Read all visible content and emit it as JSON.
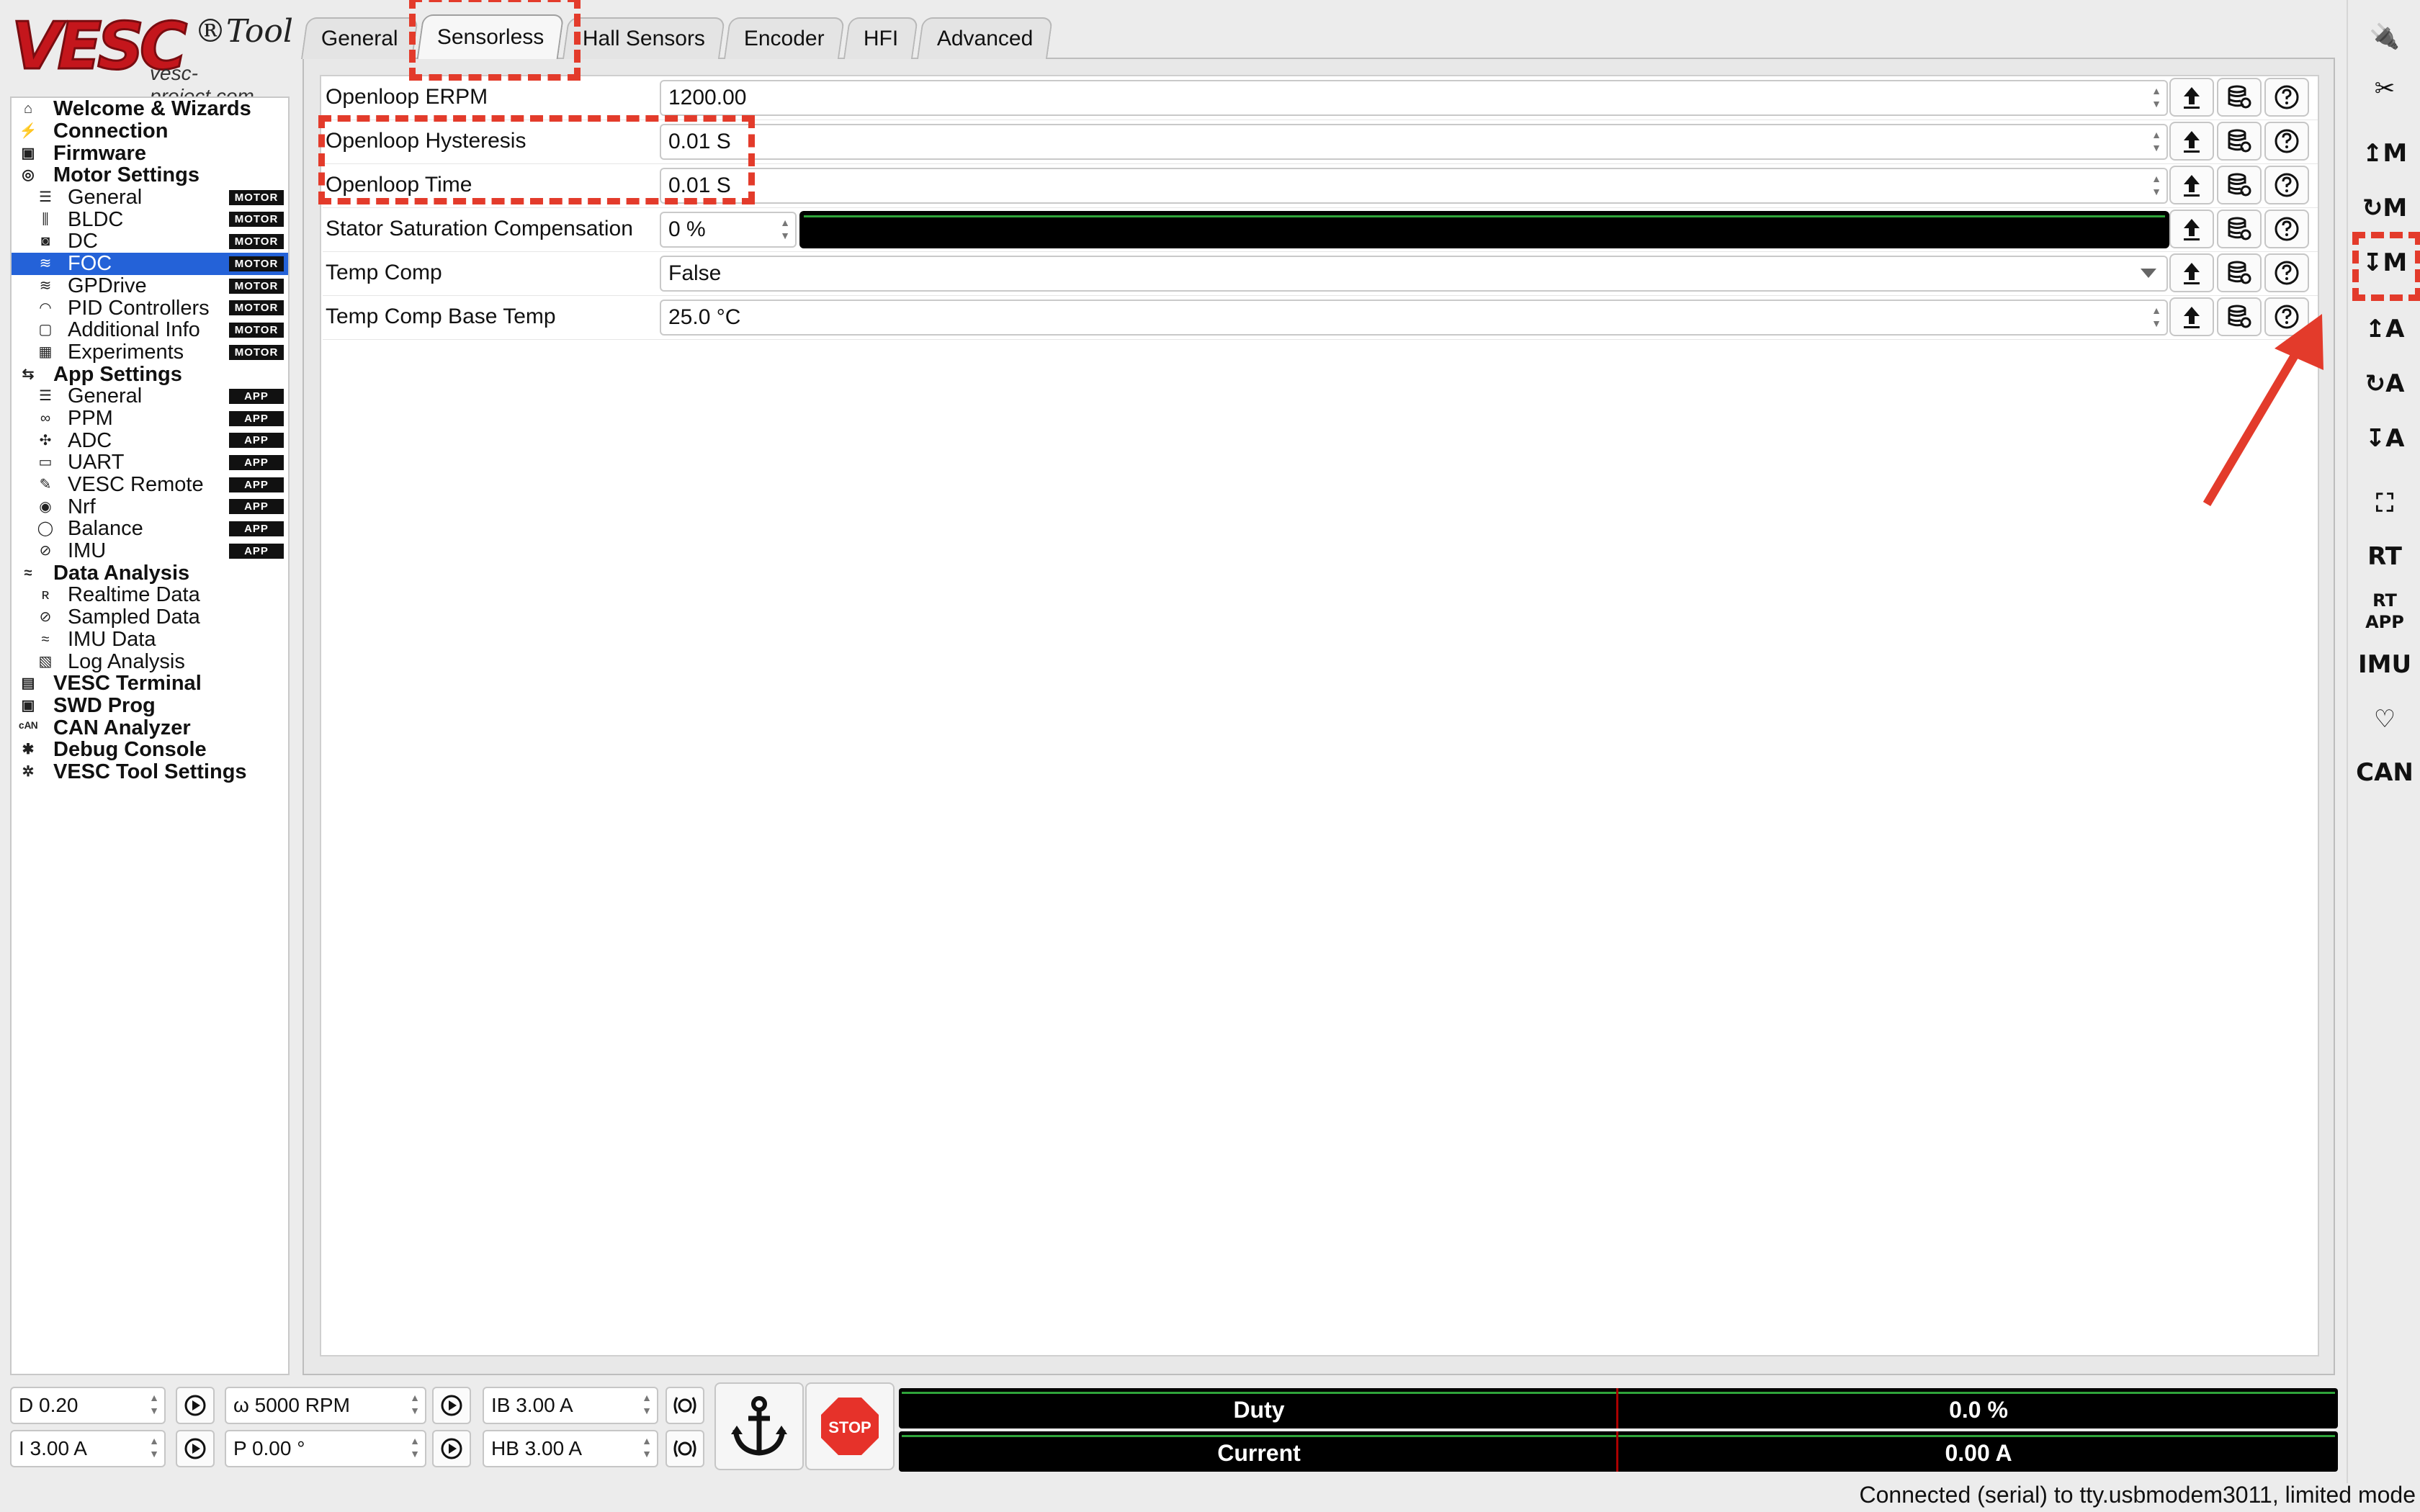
{
  "app": {
    "logo_text": "VESC",
    "logo_tool": "®Tool",
    "logo_site": "vesc-project.com"
  },
  "nav": {
    "items": [
      {
        "label": "Welcome & Wizards",
        "icon": "home-icon",
        "glyph": "⌂",
        "level": "top",
        "badge": ""
      },
      {
        "label": "Connection",
        "icon": "plug-icon",
        "glyph": "⚡",
        "level": "top",
        "badge": ""
      },
      {
        "label": "Firmware",
        "icon": "chip-icon",
        "glyph": "▣",
        "level": "top",
        "badge": ""
      },
      {
        "label": "Motor Settings",
        "icon": "motor-icon",
        "glyph": "◎",
        "level": "top",
        "badge": ""
      },
      {
        "label": "General",
        "icon": "sliders-icon",
        "glyph": "☰",
        "level": "sub",
        "badge": "MOTOR"
      },
      {
        "label": "BLDC",
        "icon": "bldc-icon",
        "glyph": "⫼",
        "level": "sub",
        "badge": "MOTOR"
      },
      {
        "label": "DC",
        "icon": "dc-motor-icon",
        "glyph": "◙",
        "level": "sub",
        "badge": "MOTOR"
      },
      {
        "label": "FOC",
        "icon": "foc-icon",
        "glyph": "≋",
        "level": "sub",
        "badge": "MOTOR",
        "selected": true
      },
      {
        "label": "GPDrive",
        "icon": "gpdrive-icon",
        "glyph": "≋",
        "level": "sub",
        "badge": "MOTOR"
      },
      {
        "label": "PID Controllers",
        "icon": "gauge-icon",
        "glyph": "◠",
        "level": "sub",
        "badge": "MOTOR"
      },
      {
        "label": "Additional Info",
        "icon": "info-icon",
        "glyph": "▢",
        "level": "sub",
        "badge": "MOTOR"
      },
      {
        "label": "Experiments",
        "icon": "calculator-icon",
        "glyph": "▦",
        "level": "sub",
        "badge": "MOTOR"
      },
      {
        "label": "App Settings",
        "icon": "app-settings-icon",
        "glyph": "⇆",
        "level": "top",
        "badge": ""
      },
      {
        "label": "General",
        "icon": "sliders-icon",
        "glyph": "☰",
        "level": "sub",
        "badge": "APP"
      },
      {
        "label": "PPM",
        "icon": "ppm-icon",
        "glyph": "∞",
        "level": "sub",
        "badge": "APP"
      },
      {
        "label": "ADC",
        "icon": "adc-icon",
        "glyph": "✣",
        "level": "sub",
        "badge": "APP"
      },
      {
        "label": "UART",
        "icon": "keyboard-icon",
        "glyph": "▭",
        "level": "sub",
        "badge": "APP"
      },
      {
        "label": "VESC Remote",
        "icon": "remote-icon",
        "glyph": "✎",
        "level": "sub",
        "badge": "APP"
      },
      {
        "label": "Nrf",
        "icon": "wireless-icon",
        "glyph": "◉",
        "level": "sub",
        "badge": "APP"
      },
      {
        "label": "Balance",
        "icon": "balance-icon",
        "glyph": "◯",
        "level": "sub",
        "badge": "APP"
      },
      {
        "label": "IMU",
        "icon": "imu-icon",
        "glyph": "⊘",
        "level": "sub",
        "badge": "APP"
      },
      {
        "label": "Data Analysis",
        "icon": "chart-icon",
        "glyph": "≈",
        "level": "top",
        "badge": ""
      },
      {
        "label": "Realtime Data",
        "icon": "realtime-icon",
        "glyph": "ʀ",
        "level": "sub",
        "badge": ""
      },
      {
        "label": "Sampled Data",
        "icon": "sampled-icon",
        "glyph": "⊘",
        "level": "sub",
        "badge": ""
      },
      {
        "label": "IMU Data",
        "icon": "imu-data-icon",
        "glyph": "≈",
        "level": "sub",
        "badge": ""
      },
      {
        "label": "Log Analysis",
        "icon": "log-icon",
        "glyph": "▧",
        "level": "sub",
        "badge": ""
      },
      {
        "label": "VESC Terminal",
        "icon": "terminal-icon",
        "glyph": "▤",
        "level": "top",
        "badge": ""
      },
      {
        "label": "SWD Prog",
        "icon": "swd-icon",
        "glyph": "▣",
        "level": "top",
        "badge": ""
      },
      {
        "label": "CAN Analyzer",
        "icon": "can-icon",
        "glyph": "ᶜᴬᴺ",
        "level": "top",
        "badge": ""
      },
      {
        "label": "Debug Console",
        "icon": "bug-icon",
        "glyph": "✱",
        "level": "top",
        "badge": ""
      },
      {
        "label": "VESC Tool Settings",
        "icon": "gear-icon",
        "glyph": "✲",
        "level": "top",
        "badge": ""
      }
    ]
  },
  "tabs": [
    {
      "label": "General",
      "active": false
    },
    {
      "label": "Sensorless",
      "active": true
    },
    {
      "label": "Hall Sensors",
      "active": false
    },
    {
      "label": "Encoder",
      "active": false
    },
    {
      "label": "HFI",
      "active": false
    },
    {
      "label": "Advanced",
      "active": false
    }
  ],
  "params": [
    {
      "label": "Openloop ERPM",
      "value": "1200.00",
      "kind": "spin"
    },
    {
      "label": "Openloop Hysteresis",
      "value": "0.01 S",
      "kind": "spin"
    },
    {
      "label": "Openloop Time",
      "value": "0.01 S",
      "kind": "spin"
    },
    {
      "label": "Stator Saturation Compensation",
      "value": "0 %",
      "kind": "slider",
      "level": 0
    },
    {
      "label": "Temp Comp",
      "value": "False",
      "kind": "dropdown"
    },
    {
      "label": "Temp Comp Base Temp",
      "value": "25.0 °C",
      "kind": "spin"
    }
  ],
  "param_buttons": {
    "write": "upload-icon",
    "read_default": "database-reset-icon",
    "help": "help-icon"
  },
  "right_toolbar": [
    {
      "name": "connect-icon",
      "label": "🔌"
    },
    {
      "name": "disconnect-icon",
      "label": "✂"
    },
    {
      "name": "write-motor-config-icon",
      "label": "↥M"
    },
    {
      "name": "read-motor-config-icon",
      "label": "↻M"
    },
    {
      "name": "read-default-motor-config-icon",
      "label": "↧M"
    },
    {
      "name": "write-app-config-icon",
      "label": "↥A"
    },
    {
      "name": "read-app-config-icon",
      "label": "↻A"
    },
    {
      "name": "read-default-app-config-icon",
      "label": "↧A"
    },
    {
      "name": "can-devices-icon",
      "label": "⛶"
    },
    {
      "name": "realtime-data-icon",
      "label": "RT"
    },
    {
      "name": "realtime-app-data-icon",
      "label": "RT APP"
    },
    {
      "name": "imu-stream-icon",
      "label": "IMU"
    },
    {
      "name": "heartbeat-icon",
      "label": "♡"
    },
    {
      "name": "can-forward-icon",
      "label": "CAN"
    }
  ],
  "controls": {
    "duty": "D 0.20",
    "current": "I 3.00 A",
    "speed": "ω 5000 RPM",
    "position": "P 0.00 °",
    "brake": "IB 3.00 A",
    "handbrake": "HB 3.00 A",
    "stop_label": "STOP"
  },
  "meters": [
    {
      "label": "Duty",
      "value": "0.0 %"
    },
    {
      "label": "Current",
      "value": "0.00 A"
    }
  ],
  "status_text": "Connected (serial) to tty.usbmodem3011, limited mode",
  "colors": {
    "accent": "#2462d8",
    "annotation": "#e33b2b",
    "meter_line": "#2fa33a"
  }
}
